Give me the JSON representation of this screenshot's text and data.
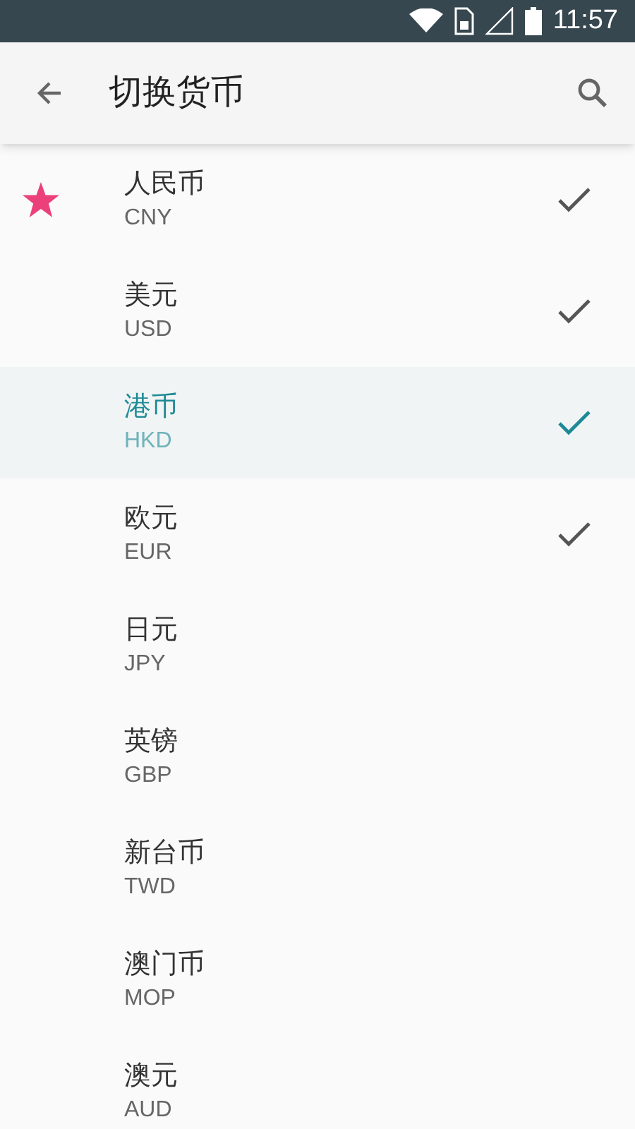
{
  "status_bar": {
    "time": "11:57"
  },
  "toolbar": {
    "title": "切换货币"
  },
  "currencies": [
    {
      "name": "人民币",
      "code": "CNY",
      "starred": true,
      "checked": true,
      "selected": false
    },
    {
      "name": "美元",
      "code": "USD",
      "starred": false,
      "checked": true,
      "selected": false
    },
    {
      "name": "港币",
      "code": "HKD",
      "starred": false,
      "checked": true,
      "selected": true
    },
    {
      "name": "欧元",
      "code": "EUR",
      "starred": false,
      "checked": true,
      "selected": false
    },
    {
      "name": "日元",
      "code": "JPY",
      "starred": false,
      "checked": false,
      "selected": false
    },
    {
      "name": "英镑",
      "code": "GBP",
      "starred": false,
      "checked": false,
      "selected": false
    },
    {
      "name": "新台币",
      "code": "TWD",
      "starred": false,
      "checked": false,
      "selected": false
    },
    {
      "name": "澳门币",
      "code": "MOP",
      "starred": false,
      "checked": false,
      "selected": false
    },
    {
      "name": "澳元",
      "code": "AUD",
      "starred": false,
      "checked": false,
      "selected": false
    }
  ]
}
